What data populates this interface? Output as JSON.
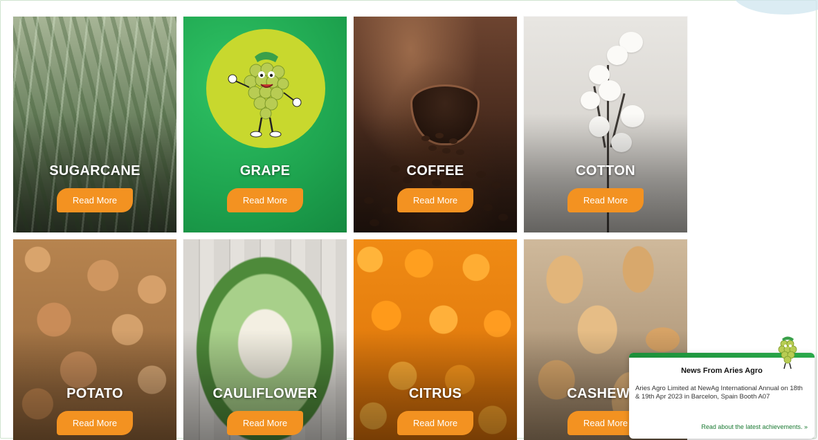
{
  "crops": [
    {
      "title": "SUGARCANE",
      "button": "Read More"
    },
    {
      "title": "GRAPE",
      "button": "Read More"
    },
    {
      "title": "COFFEE",
      "button": "Read More"
    },
    {
      "title": "COTTON",
      "button": "Read More"
    },
    {
      "title": "POTATO",
      "button": "Read More"
    },
    {
      "title": "CAULIFLOWER",
      "button": "Read More"
    },
    {
      "title": "CITRUS",
      "button": "Read More"
    },
    {
      "title": "CASHEW N",
      "button": "Read More"
    }
  ],
  "news": {
    "heading": "News From Aries Agro",
    "body": "Aries Agro Limited at NewAg International Annual on 18th & 19th Apr 2023 in Barcelon, Spain Booth A07",
    "link": "Read about the latest achievements. »"
  },
  "colors": {
    "button": "#f39221",
    "brand_green": "#1ea44f",
    "grape_circle": "#c8d82e"
  }
}
